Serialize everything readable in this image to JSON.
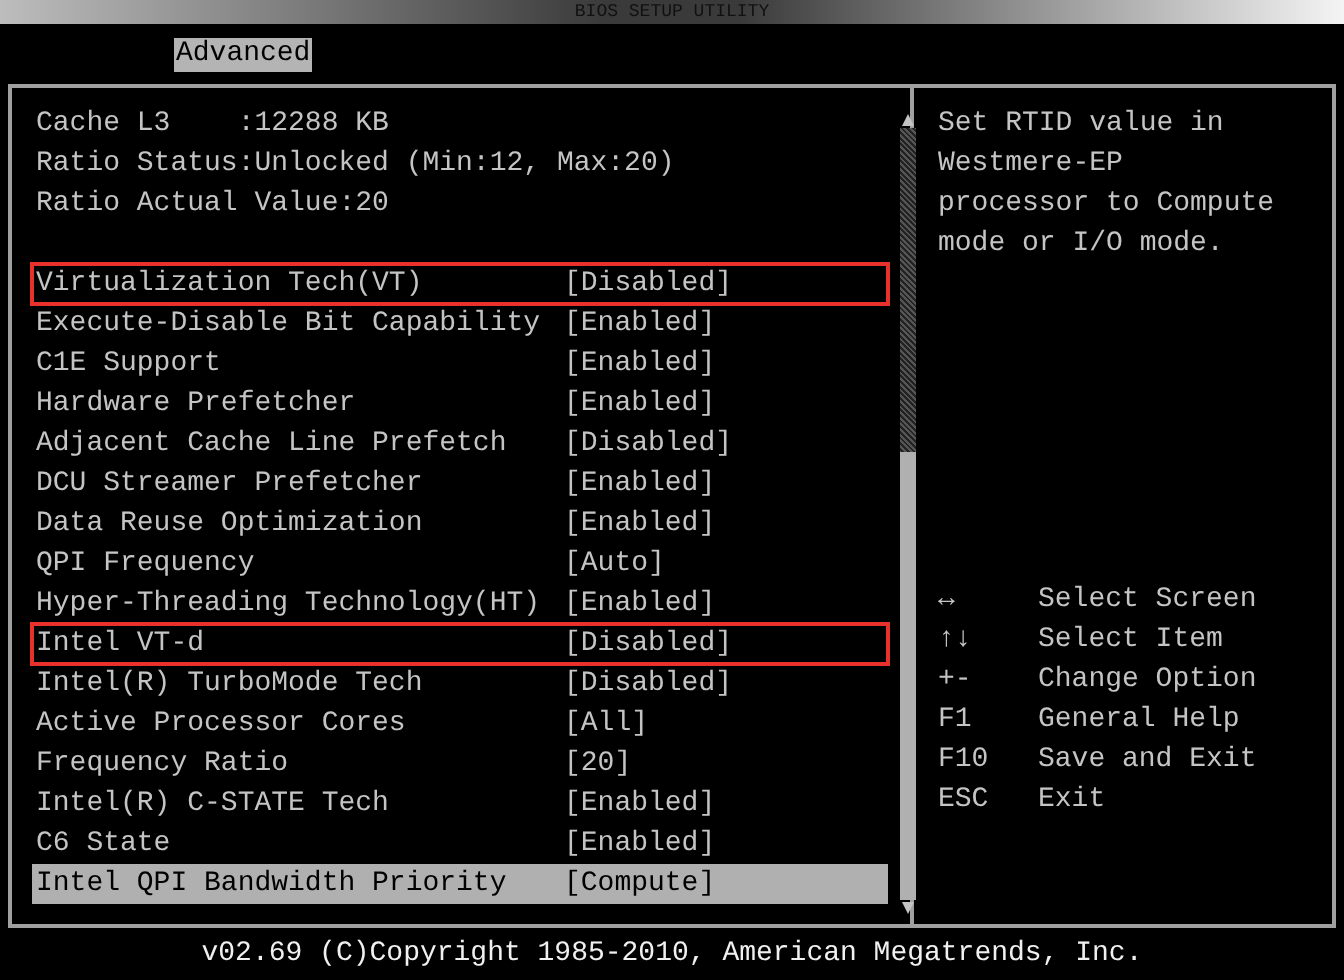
{
  "window": {
    "title": "BIOS SETUP UTILITY"
  },
  "tabs": [
    {
      "label": "Advanced",
      "selected": true
    }
  ],
  "info_lines": [
    "Cache L3    :12288 KB",
    "Ratio Status:Unlocked (Min:12, Max:20)",
    "Ratio Actual Value:20"
  ],
  "settings": [
    {
      "name": "Virtualization Tech(VT)",
      "value": "[Disabled]",
      "selected": false,
      "highlighted": true
    },
    {
      "name": "Execute-Disable Bit Capability",
      "value": "[Enabled]",
      "selected": false,
      "highlighted": false
    },
    {
      "name": "C1E Support",
      "value": "[Enabled]",
      "selected": false,
      "highlighted": false
    },
    {
      "name": "Hardware Prefetcher",
      "value": "[Enabled]",
      "selected": false,
      "highlighted": false
    },
    {
      "name": "Adjacent Cache Line Prefetch",
      "value": "[Disabled]",
      "selected": false,
      "highlighted": false
    },
    {
      "name": "DCU Streamer Prefetcher",
      "value": "[Enabled]",
      "selected": false,
      "highlighted": false
    },
    {
      "name": "Data Reuse Optimization",
      "value": "[Enabled]",
      "selected": false,
      "highlighted": false
    },
    {
      "name": "QPI Frequency",
      "value": "[Auto]",
      "selected": false,
      "highlighted": false
    },
    {
      "name": "Hyper-Threading Technology(HT)",
      "value": "[Enabled]",
      "selected": false,
      "highlighted": false
    },
    {
      "name": "Intel VT-d",
      "value": "[Disabled]",
      "selected": false,
      "highlighted": true
    },
    {
      "name": "Intel(R) TurboMode Tech",
      "value": "[Disabled]",
      "selected": false,
      "highlighted": false
    },
    {
      "name": "Active Processor Cores",
      "value": "[All]",
      "selected": false,
      "highlighted": false
    },
    {
      "name": "Frequency Ratio",
      "value": "[20]",
      "selected": false,
      "highlighted": false
    },
    {
      "name": "Intel(R) C-STATE Tech",
      "value": "[Enabled]",
      "selected": false,
      "highlighted": false
    },
    {
      "name": "C6 State",
      "value": "[Enabled]",
      "selected": false,
      "highlighted": false
    },
    {
      "name": "Intel QPI Bandwidth Priority",
      "value": "[Compute]",
      "selected": true,
      "highlighted": false
    }
  ],
  "help_text": "Set RTID value in Westmere-EP processor to Compute mode or I/O mode.",
  "key_help": [
    {
      "key": "↔",
      "action": "Select Screen"
    },
    {
      "key": "↑↓",
      "action": "Select Item"
    },
    {
      "key": "+-",
      "action": "Change Option"
    },
    {
      "key": "F1",
      "action": "General Help"
    },
    {
      "key": "F10",
      "action": "Save and Exit"
    },
    {
      "key": "ESC",
      "action": "Exit"
    }
  ],
  "footer": "v02.69 (C)Copyright 1985-2010, American Megatrends, Inc."
}
